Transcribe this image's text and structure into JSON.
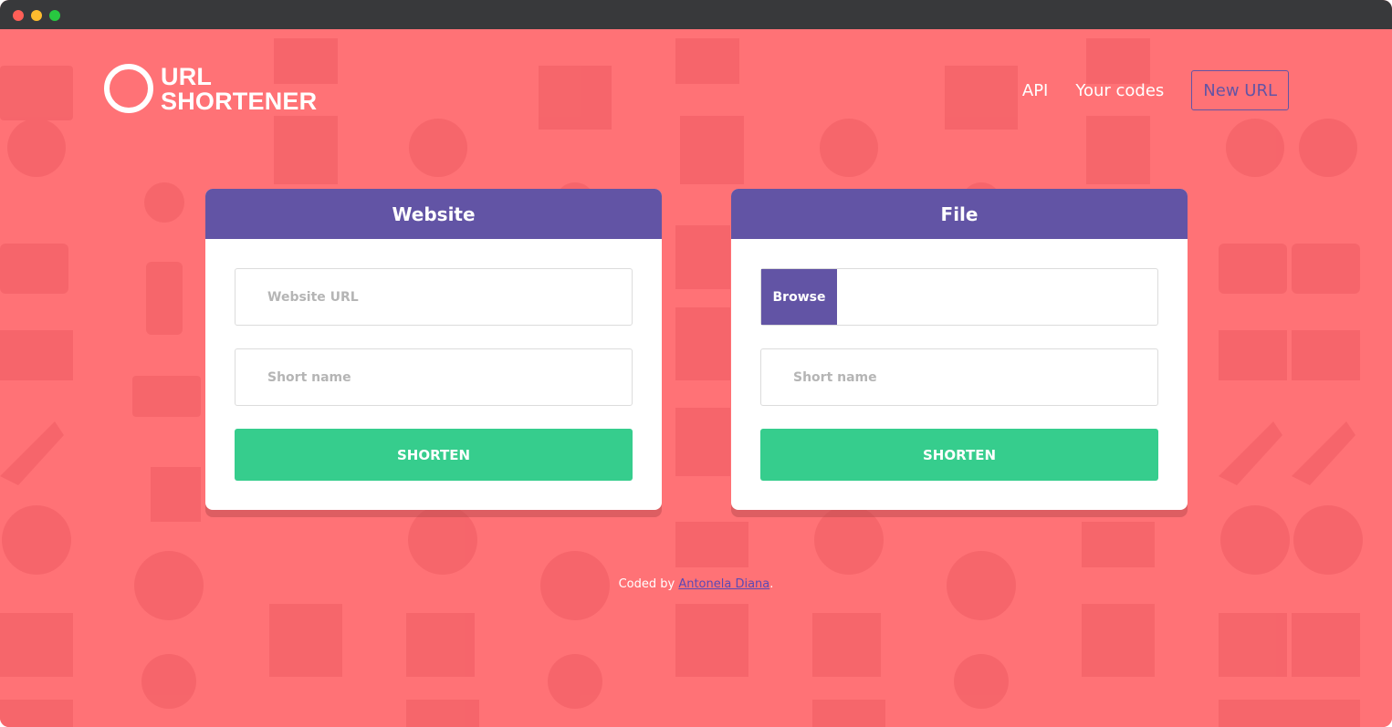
{
  "logo": {
    "line1": "URL",
    "line2": "SHORTENER"
  },
  "nav": {
    "api": "API",
    "your_codes": "Your codes",
    "new_url": "New URL"
  },
  "website_card": {
    "title": "Website",
    "url_placeholder": "Website URL",
    "short_placeholder": "Short name",
    "button": "SHORTEN"
  },
  "file_card": {
    "title": "File",
    "browse": "Browse",
    "short_placeholder": "Short name",
    "button": "SHORTEN"
  },
  "footer": {
    "prefix": "Coded by ",
    "author": "Antonela Diana",
    "suffix": "."
  },
  "colors": {
    "background": "#ff7276",
    "primary": "#6254a5",
    "success": "#36cd8d"
  }
}
